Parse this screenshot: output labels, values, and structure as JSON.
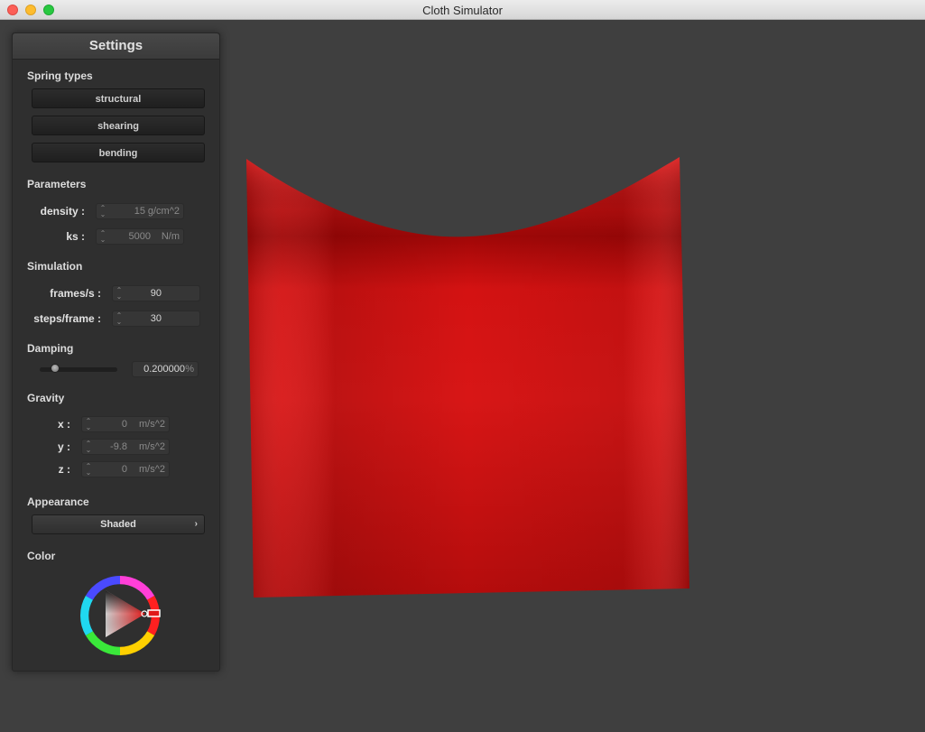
{
  "window": {
    "title": "Cloth Simulator"
  },
  "settings": {
    "title": "Settings",
    "spring_types": {
      "heading": "Spring types",
      "buttons": [
        "structural",
        "shearing",
        "bending"
      ]
    },
    "parameters": {
      "heading": "Parameters",
      "density": {
        "label": "density :",
        "value": "15",
        "unit": "g/cm^2"
      },
      "ks": {
        "label": "ks :",
        "value": "5000",
        "unit": "N/m"
      }
    },
    "simulation": {
      "heading": "Simulation",
      "frames": {
        "label": "frames/s :",
        "value": "90"
      },
      "steps": {
        "label": "steps/frame :",
        "value": "30"
      }
    },
    "damping": {
      "heading": "Damping",
      "value": "0.200000",
      "unit": "%",
      "slider_fraction": 0.2
    },
    "gravity": {
      "heading": "Gravity",
      "x": {
        "label": "x :",
        "value": "0",
        "unit": "m/s^2"
      },
      "y": {
        "label": "y :",
        "value": "-9.8",
        "unit": "m/s^2"
      },
      "z": {
        "label": "z :",
        "value": "0",
        "unit": "m/s^2"
      }
    },
    "appearance": {
      "heading": "Appearance",
      "selected": "Shaded",
      "arrow_icon": "chevron-right-icon"
    },
    "color": {
      "heading": "Color",
      "selected_hex": "#e01a1a"
    }
  },
  "scene": {
    "background": "#3f3f3f",
    "cloth_color": "#d41313"
  }
}
